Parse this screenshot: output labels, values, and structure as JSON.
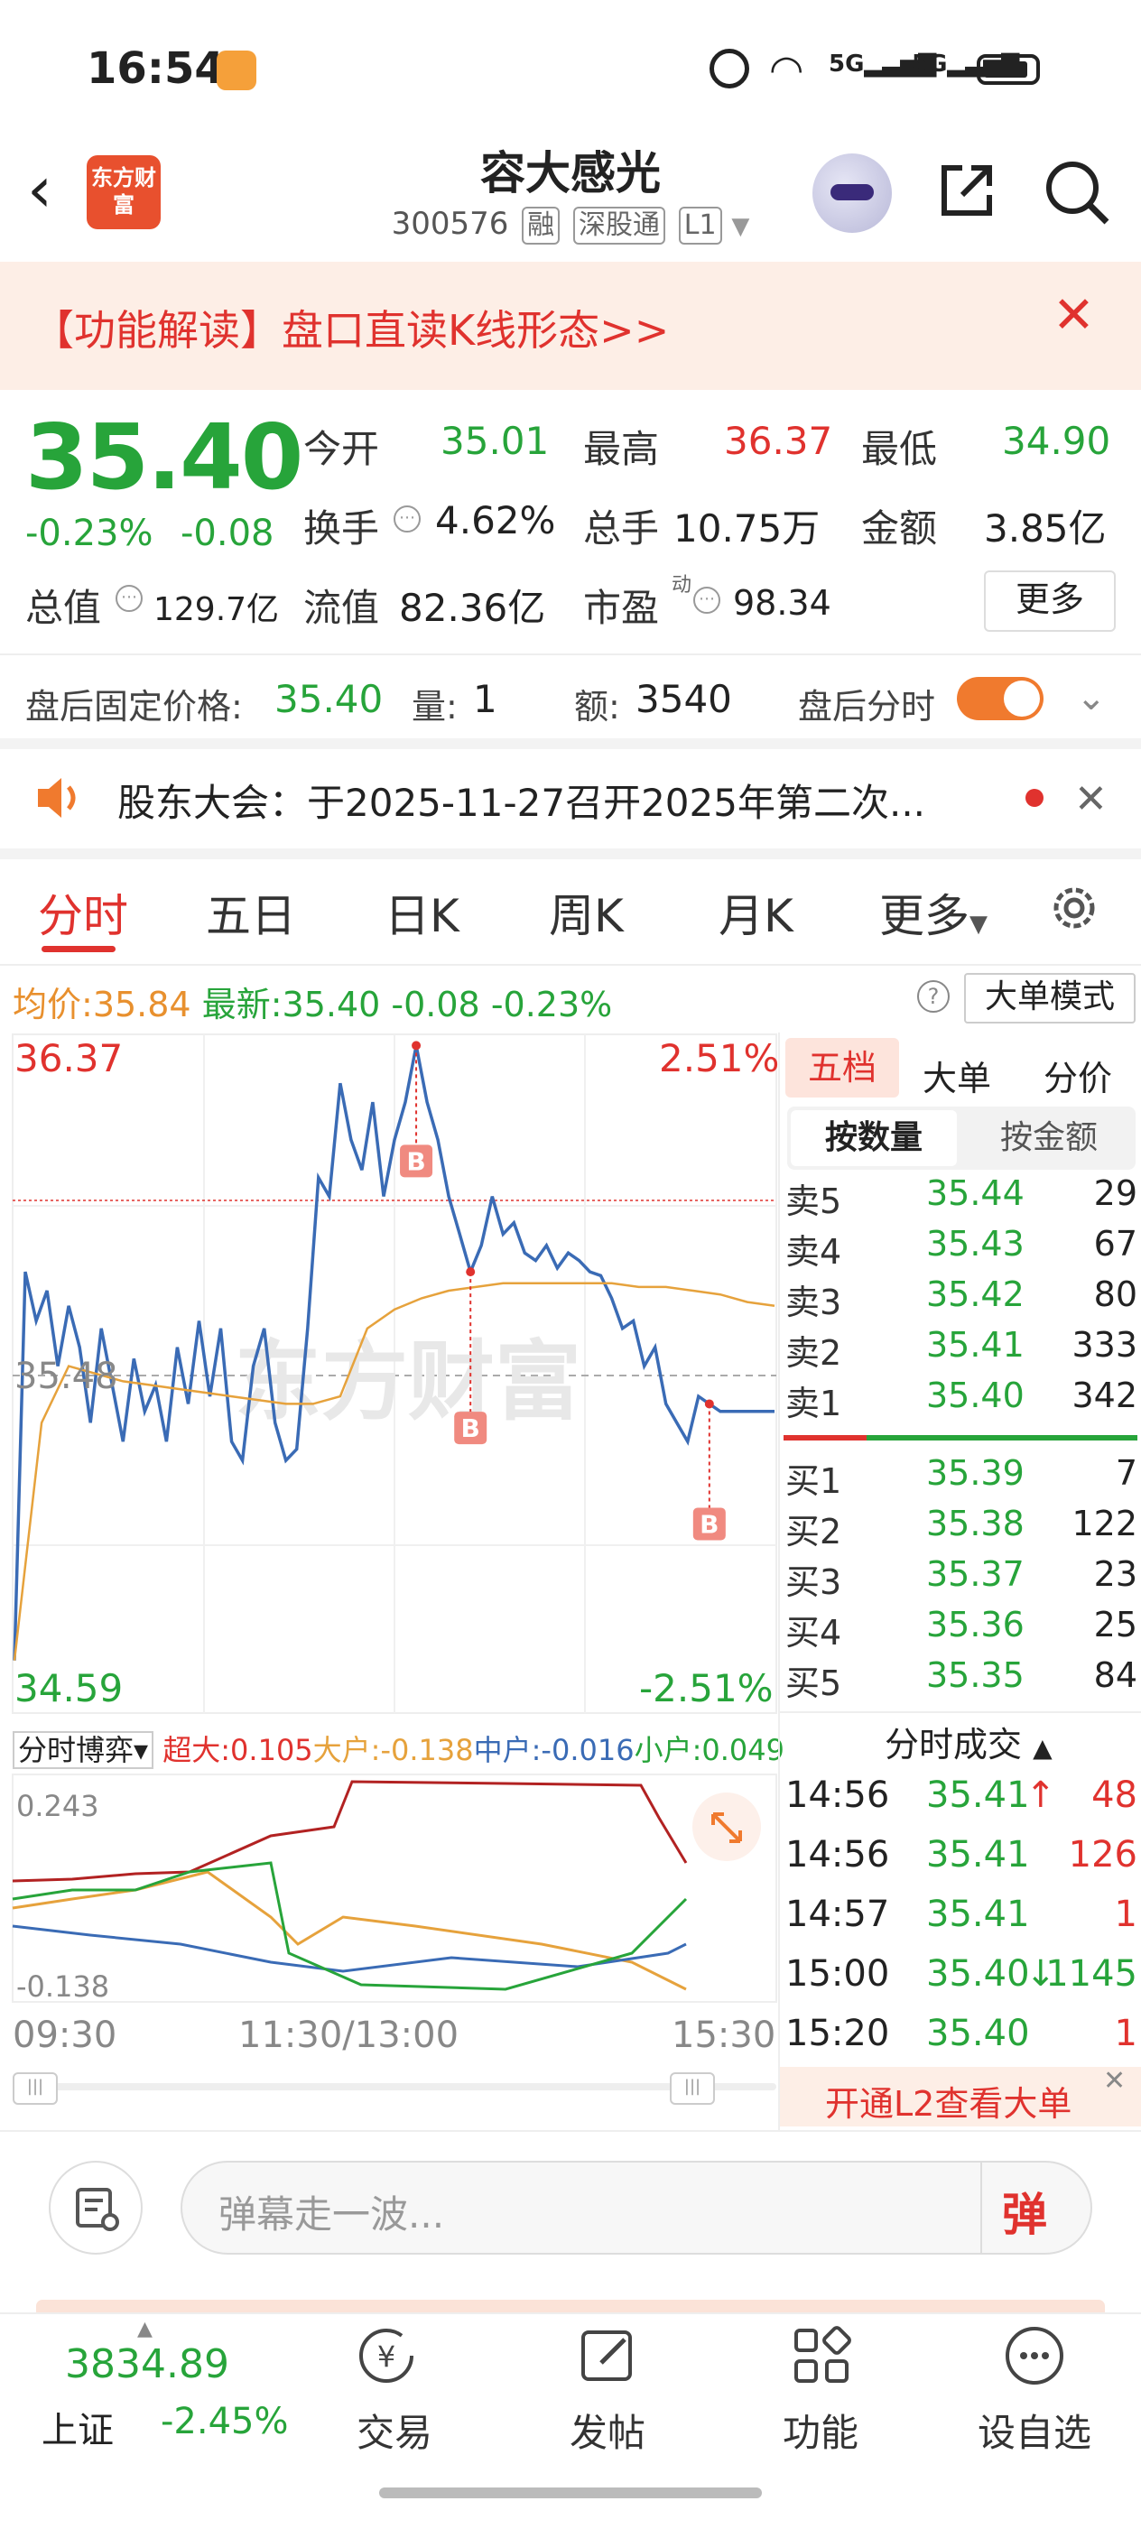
{
  "status_bar": {
    "time": "16:54"
  },
  "header": {
    "stock_name": "容大感光",
    "stock_code": "300576",
    "tags": [
      "融",
      "深股通",
      "L1"
    ],
    "logo_text": "东方财富"
  },
  "banner": {
    "text": "【功能解读】盘口直读K线形态>>"
  },
  "quote": {
    "price": "35.40",
    "change_pct": "-0.23%",
    "change": "-0.08",
    "open_label": "今开",
    "open": "35.01",
    "high_label": "最高",
    "high": "36.37",
    "low_label": "最低",
    "low": "34.90",
    "turnover_label": "换手",
    "turnover": "4.62%",
    "volume_label": "总手",
    "volume": "10.75万",
    "amount_label": "金额",
    "amount": "3.85亿",
    "mktcap_label": "总值",
    "mktcap": "129.7亿",
    "float_label": "流值",
    "float_cap": "82.36亿",
    "pe_label": "市盈",
    "pe_sup": "动",
    "pe": "98.34",
    "more_button": "更多"
  },
  "after_hours": {
    "price_label": "盘后固定价格:",
    "price": "35.40",
    "vol_label": "量:",
    "vol": "1",
    "amt_label": "额:",
    "amt": "3540",
    "toggle_label": "盘后分时"
  },
  "notice": {
    "text": "股东大会：于2025-11-27召开2025年第二次..."
  },
  "tabs": [
    "分时",
    "五日",
    "日K",
    "周K",
    "月K",
    "更多"
  ],
  "chart_header": {
    "avg_label": "均价:",
    "avg": "35.84",
    "latest_label": "最新:",
    "latest": "35.40",
    "chg": "-0.08",
    "chg_pct": "-0.23%",
    "mode_button": "大单模式"
  },
  "chart_data": {
    "type": "line",
    "y_max": "36.37",
    "y_min": "34.59",
    "y_ref": "35.48",
    "pct_max": "2.51%",
    "pct_min": "-2.51%",
    "ylim": [
      34.59,
      36.37
    ],
    "x_labels": [
      "09:30",
      "11:30/13:00",
      "15:30"
    ],
    "series": [
      {
        "color": "#3a6bb5",
        "values": [
          34.72,
          35.75,
          35.62,
          35.7,
          35.5,
          35.66,
          35.55,
          35.35,
          35.6,
          35.45,
          35.3,
          35.52,
          35.38,
          35.45,
          35.3,
          35.55,
          35.4,
          35.62,
          35.42,
          35.6,
          35.3,
          35.25,
          35.5,
          35.6,
          35.35,
          35.25,
          35.28,
          35.6,
          36.0,
          35.95,
          36.25,
          36.1,
          36.02,
          36.2,
          35.95,
          36.1,
          36.2,
          36.35,
          36.2,
          36.1,
          35.95,
          35.85,
          35.75,
          35.82,
          35.95,
          35.85,
          35.88,
          35.8,
          35.78,
          35.82,
          35.76,
          35.8,
          35.78,
          35.75,
          35.74,
          35.68,
          35.6,
          35.62,
          35.5,
          35.55,
          35.4,
          35.35,
          35.3,
          35.42,
          35.4,
          35.38,
          35.38,
          35.38,
          35.38,
          35.38,
          35.38
        ]
      },
      {
        "color": "#e6a23c",
        "values": [
          34.72,
          35.35,
          35.5,
          35.48,
          35.46,
          35.45,
          35.44,
          35.43,
          35.42,
          35.41,
          35.4,
          35.4,
          35.42,
          35.6,
          35.65,
          35.68,
          35.7,
          35.71,
          35.72,
          35.72,
          35.72,
          35.72,
          35.72,
          35.71,
          35.71,
          35.7,
          35.69,
          35.67,
          35.66
        ]
      }
    ],
    "buy_marks": [
      "B",
      "B",
      "B"
    ]
  },
  "order_book": {
    "tabs": [
      "五档",
      "大单",
      "分价"
    ],
    "subtabs": [
      "按数量",
      "按金额"
    ],
    "asks": [
      {
        "label": "卖5",
        "price": "35.44",
        "vol": "29"
      },
      {
        "label": "卖4",
        "price": "35.43",
        "vol": "67"
      },
      {
        "label": "卖3",
        "price": "35.42",
        "vol": "80"
      },
      {
        "label": "卖2",
        "price": "35.41",
        "vol": "333"
      },
      {
        "label": "卖1",
        "price": "35.40",
        "vol": "342"
      }
    ],
    "bids": [
      {
        "label": "买1",
        "price": "35.39",
        "vol": "7"
      },
      {
        "label": "买2",
        "price": "35.38",
        "vol": "122"
      },
      {
        "label": "买3",
        "price": "35.37",
        "vol": "23"
      },
      {
        "label": "买4",
        "price": "35.36",
        "vol": "25"
      },
      {
        "label": "买5",
        "price": "35.35",
        "vol": "84"
      }
    ],
    "ticks_title": "分时成交",
    "ticks": [
      {
        "time": "14:56",
        "price": "35.41",
        "arrow": "↑",
        "vol": "48",
        "color": "red"
      },
      {
        "time": "14:56",
        "price": "35.41",
        "arrow": "",
        "vol": "126",
        "color": "red"
      },
      {
        "time": "14:57",
        "price": "35.41",
        "arrow": "",
        "vol": "1",
        "color": "red"
      },
      {
        "time": "15:00",
        "price": "35.40",
        "arrow": "↓",
        "vol": "1145",
        "color": "green"
      },
      {
        "time": "15:20",
        "price": "35.40",
        "arrow": "",
        "vol": "1",
        "color": "red"
      }
    ],
    "l2_promo": "开通L2查看大单"
  },
  "flow": {
    "selector": "分时博弈",
    "super_label": "超大:",
    "super": "0.105",
    "big_label": "大户:",
    "big": "-0.138",
    "mid_label": "中户:",
    "mid": "-0.016",
    "small_label": "小户:",
    "small": "0.049",
    "top": "0.243",
    "bottom": "-0.138"
  },
  "comment": {
    "placeholder": "弹幕走一波...",
    "send": "弹"
  },
  "bottom_nav": {
    "index_value": "3834.89",
    "index_name": "上证",
    "index_chg": "-2.45%",
    "items": [
      "交易",
      "发帖",
      "功能",
      "设自选"
    ]
  }
}
